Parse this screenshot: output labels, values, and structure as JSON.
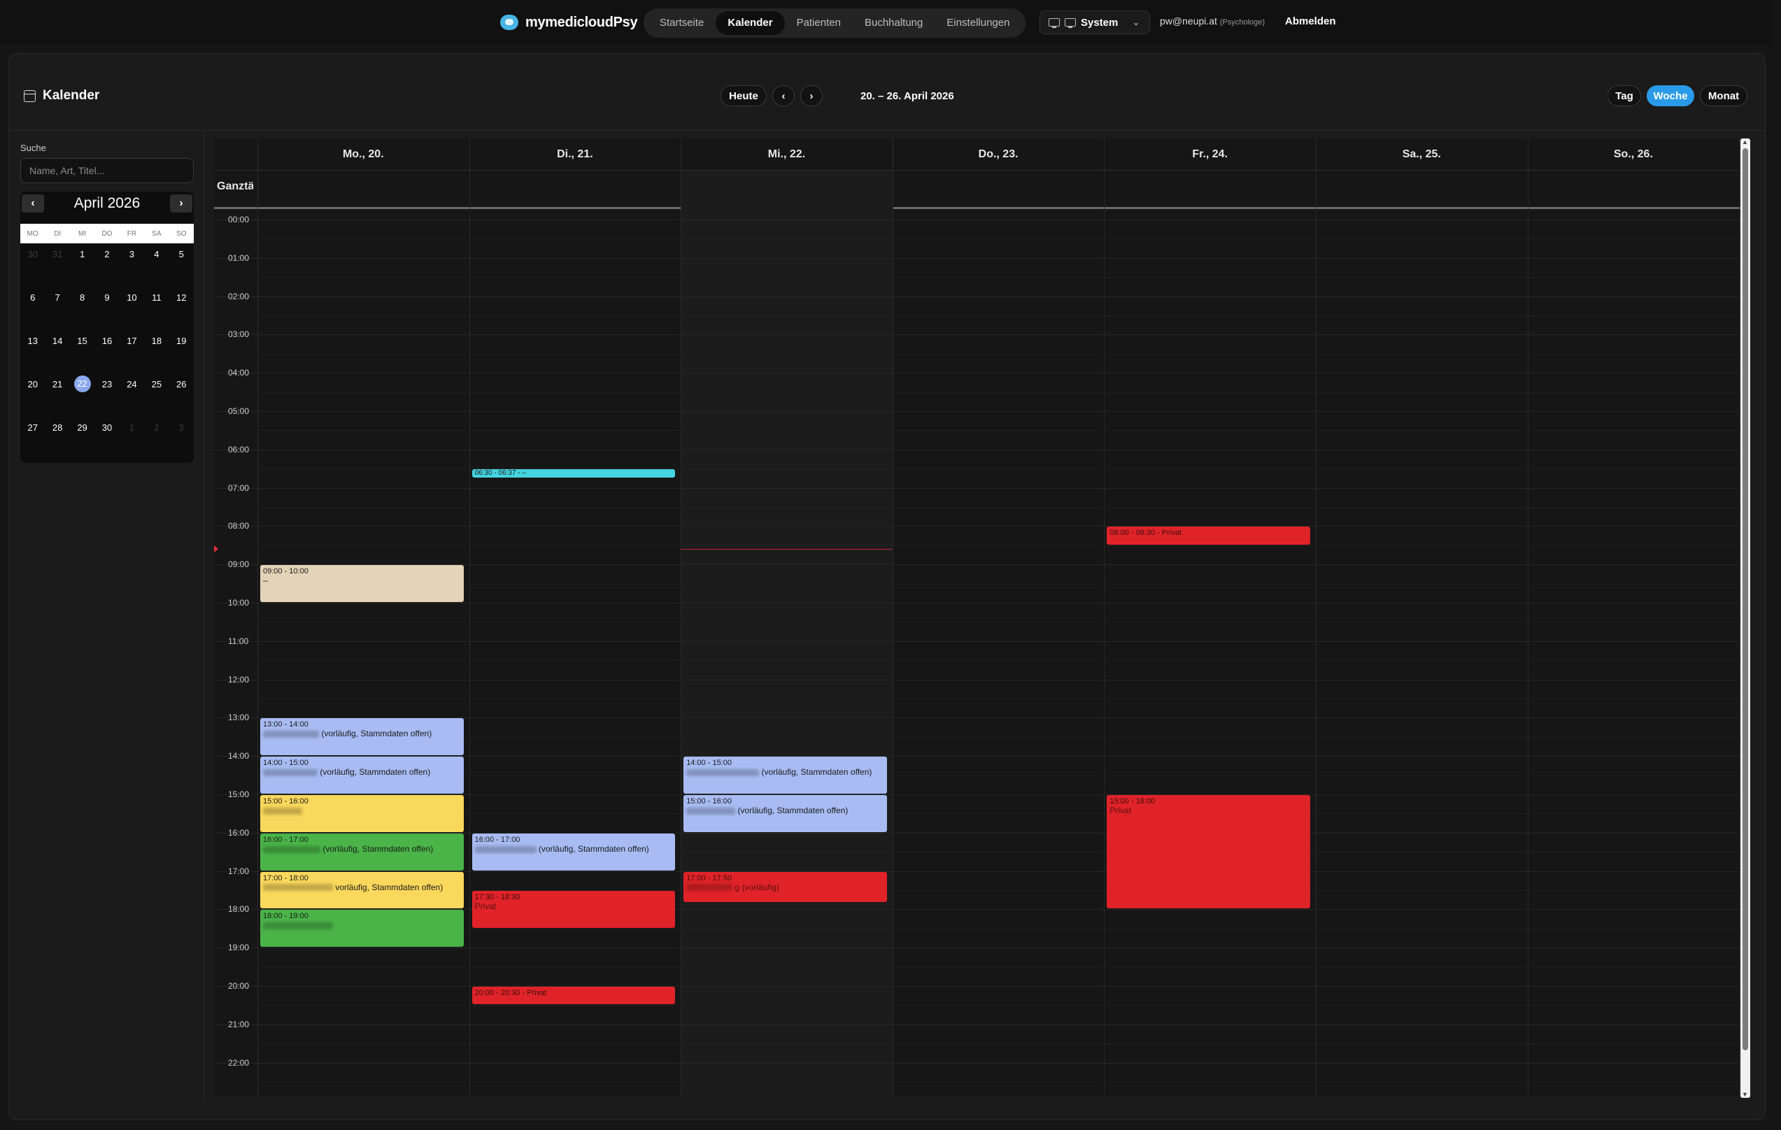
{
  "app": {
    "name": "mymedicloudPsy",
    "nav": [
      "Startseite",
      "Kalender",
      "Patienten",
      "Buchhaltung",
      "Einstellungen"
    ],
    "theme_select": "System",
    "user_email": "pw@neupi.at",
    "user_role": "(Psychologe)",
    "logout": "Abmelden"
  },
  "calendar": {
    "title": "Kalender",
    "today_button": "Heute",
    "prev": "‹",
    "next": "›",
    "range": "20. – 26. April 2026",
    "views": [
      "Tag",
      "Woche",
      "Monat"
    ],
    "active_view": "Woche"
  },
  "sidebar": {
    "search_label": "Suche",
    "search_placeholder": "Name, Art, Titel...",
    "minical": {
      "month": "April 2026",
      "prev": "‹",
      "next": "›",
      "weekdays": [
        "MO",
        "DI",
        "MI",
        "DO",
        "FR",
        "SA",
        "SO"
      ],
      "days": [
        "30",
        "31",
        "1",
        "2",
        "3",
        "4",
        "5",
        "6",
        "7",
        "8",
        "9",
        "10",
        "11",
        "12",
        "13",
        "14",
        "15",
        "16",
        "17",
        "18",
        "19",
        "20",
        "21",
        "22",
        "23",
        "24",
        "25",
        "26",
        "27",
        "28",
        "29",
        "30",
        "1",
        "2",
        "3"
      ],
      "muted": [
        0,
        1,
        32,
        33,
        34
      ],
      "today_index": 23
    }
  },
  "week": {
    "allday_label": "Ganztägig",
    "days": [
      "Mo., 20.",
      "Di., 21.",
      "Mi., 22.",
      "Do., 23.",
      "Fr., 24.",
      "Sa., 25.",
      "So., 26."
    ],
    "today_col": 2,
    "now_time": 8.6,
    "hours": [
      "00:00",
      "01:00",
      "02:00",
      "03:00",
      "04:00",
      "05:00",
      "06:00",
      "07:00",
      "08:00",
      "09:00",
      "10:00",
      "11:00",
      "12:00",
      "13:00",
      "14:00",
      "15:00",
      "16:00",
      "17:00",
      "18:00",
      "19:00",
      "20:00",
      "21:00",
      "22:00"
    ],
    "events": [
      {
        "day": 1,
        "start": 6.5,
        "end": 6.62,
        "time": "06:30 - 06:37 - –",
        "title": "",
        "color": "cyan"
      },
      {
        "day": 4,
        "start": 8.0,
        "end": 8.5,
        "time": "08:00 - 08:30 - Privat",
        "title": "",
        "color": "red"
      },
      {
        "day": 0,
        "start": 9.0,
        "end": 10.0,
        "time": "09:00 - 10:00",
        "title": "–",
        "color": "beige"
      },
      {
        "day": 0,
        "start": 13.0,
        "end": 14.0,
        "time": "13:00 - 14:00",
        "title": "(vorläufig, Stammdaten offen)",
        "color": "blue",
        "redacted": 80
      },
      {
        "day": 0,
        "start": 14.0,
        "end": 15.0,
        "time": "14:00 - 15:00",
        "title": "(vorläufig, Stammdaten offen)",
        "color": "blue",
        "redacted": 78
      },
      {
        "day": 0,
        "start": 15.0,
        "end": 16.0,
        "time": "15:00 - 16:00",
        "title": "",
        "color": "yellow",
        "redacted": 56
      },
      {
        "day": 0,
        "start": 16.0,
        "end": 17.0,
        "time": "16:00 - 17:00",
        "title": "(vorläufig, Stammdaten offen)",
        "color": "green",
        "redacted": 82
      },
      {
        "day": 0,
        "start": 17.0,
        "end": 18.0,
        "time": "17:00 - 18:00",
        "title": "vorläufig, Stammdaten offen)",
        "color": "yellow",
        "redacted": 100
      },
      {
        "day": 0,
        "start": 18.0,
        "end": 19.0,
        "time": "18:00 - 19:00",
        "title": "",
        "color": "green",
        "redacted": 100
      },
      {
        "day": 1,
        "start": 16.0,
        "end": 17.0,
        "time": "16:00 - 17:00",
        "title": "(vorläufig, Stammdaten offen)",
        "color": "blue",
        "redacted": 88
      },
      {
        "day": 1,
        "start": 17.5,
        "end": 18.5,
        "time": "17:30 - 18:30",
        "title": "Privat",
        "color": "red"
      },
      {
        "day": 1,
        "start": 20.0,
        "end": 20.5,
        "time": "20:00 - 20:30 - Privat",
        "title": "",
        "color": "red"
      },
      {
        "day": 2,
        "start": 14.0,
        "end": 15.0,
        "time": "14:00 - 15:00",
        "title": "(vorläufig, Stammdaten offen)",
        "color": "blue",
        "redacted": 104
      },
      {
        "day": 2,
        "start": 15.0,
        "end": 16.0,
        "time": "15:00 - 16:00",
        "title": "(vorläufig, Stammdaten offen)",
        "color": "blue",
        "redacted": 70
      },
      {
        "day": 2,
        "start": 17.0,
        "end": 17.83,
        "time": "17:00 - 17:50",
        "title": "g (vorläufig)",
        "color": "red",
        "redacted": 66
      },
      {
        "day": 4,
        "start": 15.0,
        "end": 18.0,
        "time": "15:00 - 18:00",
        "title": "Privat",
        "color": "red"
      }
    ]
  },
  "colors": {
    "accent": "#2a9be8",
    "blue": "#a8bcf3",
    "yellow": "#fad85c",
    "green": "#4ab448",
    "red": "#e02329",
    "beige": "#e3d3b8",
    "cyan": "#45d3df"
  }
}
